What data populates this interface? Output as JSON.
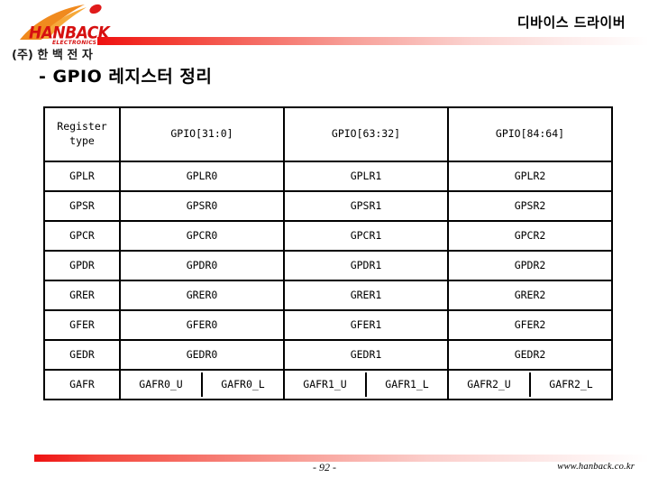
{
  "header": {
    "title": "디바이스 드라이버",
    "rule_color_start": "#ee1111",
    "rule_color_end": "#ffffff"
  },
  "logo": {
    "wordmark": "HANBACK",
    "subtitle": "ELECTRONICS",
    "korean_name": "(주) 한 백 전 자",
    "swoosh_color": "#f08a1e",
    "dot_color": "#e01b1b",
    "wordmark_color": "#d61010"
  },
  "slide": {
    "title": "- GPIO 레지스터 정리"
  },
  "table": {
    "columns": [
      "Register type",
      "GPIO[31:0]",
      "GPIO[63:32]",
      "GPIO[84:64]"
    ],
    "rows": [
      {
        "type": "GPLR",
        "cells": [
          "GPLR0",
          "GPLR1",
          "GPLR2"
        ],
        "split": false
      },
      {
        "type": "GPSR",
        "cells": [
          "GPSR0",
          "GPSR1",
          "GPSR2"
        ],
        "split": false
      },
      {
        "type": "GPCR",
        "cells": [
          "GPCR0",
          "GPCR1",
          "GPCR2"
        ],
        "split": false
      },
      {
        "type": "GPDR",
        "cells": [
          "GPDR0",
          "GPDR1",
          "GPDR2"
        ],
        "split": false
      },
      {
        "type": "GRER",
        "cells": [
          "GRER0",
          "GRER1",
          "GRER2"
        ],
        "split": false
      },
      {
        "type": "GFER",
        "cells": [
          "GFER0",
          "GFER1",
          "GFER2"
        ],
        "split": false
      },
      {
        "type": "GEDR",
        "cells": [
          "GEDR0",
          "GEDR1",
          "GEDR2"
        ],
        "split": false
      },
      {
        "type": "GAFR",
        "cells": [
          "GAFR0_U",
          "GAFR0_L",
          "GAFR1_U",
          "GAFR1_L",
          "GAFR2_U",
          "GAFR2_L"
        ],
        "split": true
      }
    ]
  },
  "footer": {
    "page_number": "- 92 -",
    "url": "www.hanback.co.kr",
    "rule_color_start": "#ee1111",
    "rule_color_end": "#ffffff"
  }
}
